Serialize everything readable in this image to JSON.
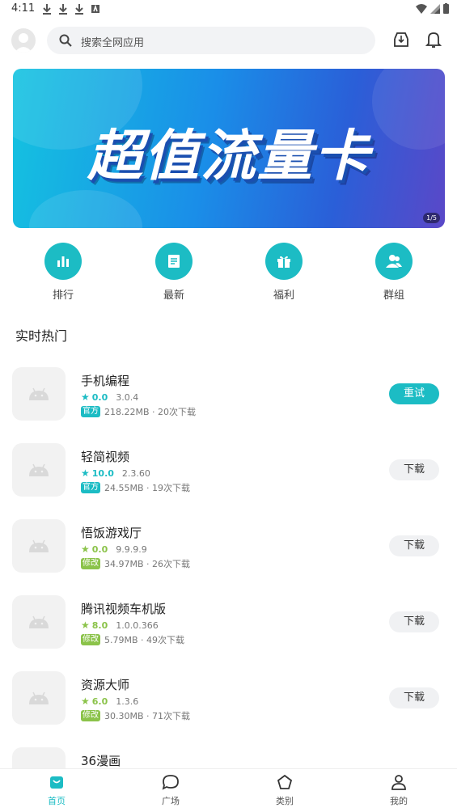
{
  "status_bar": {
    "time": "4:11"
  },
  "search": {
    "placeholder": "搜索全网应用"
  },
  "banner": {
    "title": "超值流量卡",
    "pager": "1/5"
  },
  "quick_entries": [
    {
      "label": "排行",
      "icon": "bar-chart-icon"
    },
    {
      "label": "最新",
      "icon": "news-icon"
    },
    {
      "label": "福利",
      "icon": "gift-icon"
    },
    {
      "label": "群组",
      "icon": "group-icon"
    }
  ],
  "section": {
    "title": "实时热门"
  },
  "apps": [
    {
      "name": "手机编程",
      "rating": "0.0",
      "version": "3.0.4",
      "tag": "官方",
      "tag_color": "#1cbcc4",
      "star_color": "#1cbcc4",
      "size": "218.22MB · 20次下载",
      "button": "重试",
      "button_style": "retry"
    },
    {
      "name": "轻简视频",
      "rating": "10.0",
      "version": "2.3.60",
      "tag": "官方",
      "tag_color": "#1cbcc4",
      "star_color": "#1cbcc4",
      "size": "24.55MB · 19次下载",
      "button": "下载",
      "button_style": "dl"
    },
    {
      "name": "悟饭游戏厅",
      "rating": "0.0",
      "version": "9.9.9.9",
      "tag": "修改",
      "tag_color": "#8bc34a",
      "star_color": "#8bc34a",
      "size": "34.97MB · 26次下载",
      "button": "下载",
      "button_style": "dl"
    },
    {
      "name": "腾讯视频车机版",
      "rating": "8.0",
      "version": "1.0.0.366",
      "tag": "修改",
      "tag_color": "#8bc34a",
      "star_color": "#8bc34a",
      "size": "5.79MB · 49次下载",
      "button": "下载",
      "button_style": "dl"
    },
    {
      "name": "资源大师",
      "rating": "6.0",
      "version": "1.3.6",
      "tag": "修改",
      "tag_color": "#8bc34a",
      "star_color": "#8bc34a",
      "size": "30.30MB · 71次下载",
      "button": "下载",
      "button_style": "dl"
    },
    {
      "name": "36漫画"
    }
  ],
  "bottom_nav": [
    {
      "label": "首页",
      "icon": "home-icon",
      "active": true
    },
    {
      "label": "广场",
      "icon": "chat-bubble-icon",
      "active": false
    },
    {
      "label": "类别",
      "icon": "pentagon-icon",
      "active": false
    },
    {
      "label": "我的",
      "icon": "person-icon",
      "active": false
    }
  ],
  "colors": {
    "accent": "#1cbcc4",
    "mod_tag": "#8bc34a"
  }
}
